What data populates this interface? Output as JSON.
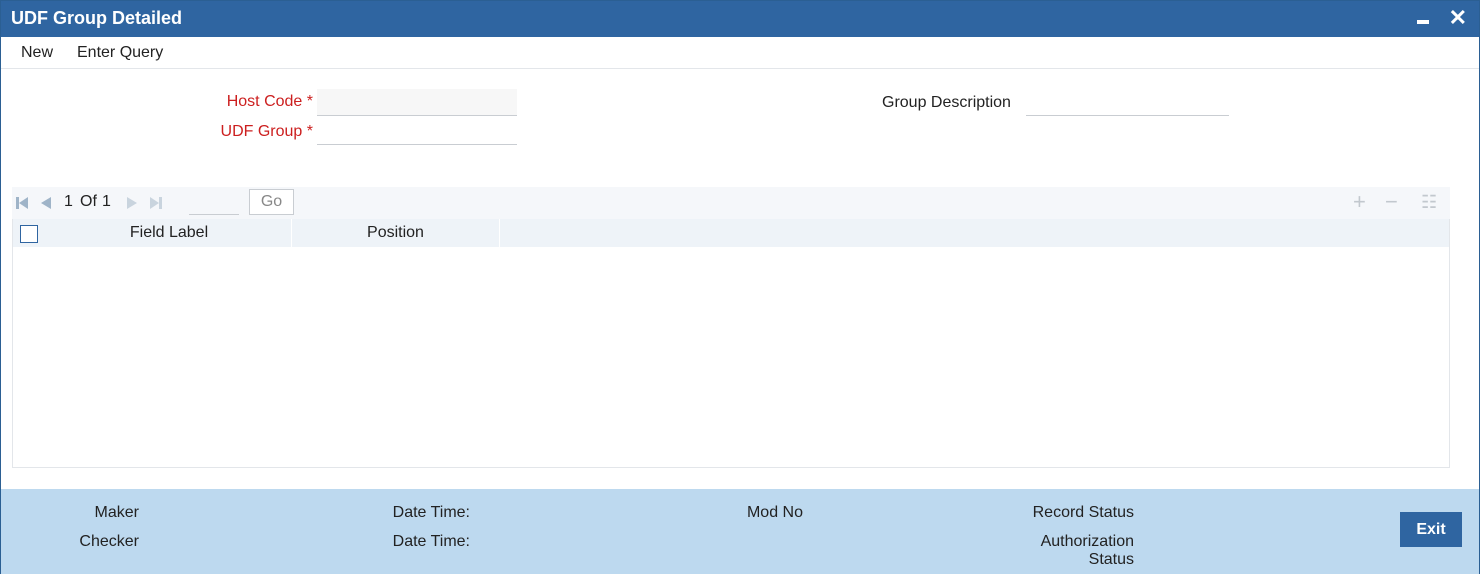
{
  "window": {
    "title": "UDF Group Detailed",
    "minimize_icon": "minimize-icon",
    "close_symbol": "✕"
  },
  "menu": {
    "new_label": "New",
    "enter_query_label": "Enter Query"
  },
  "form": {
    "host_code_label": "Host Code",
    "host_code_value": "",
    "udf_group_label": "UDF Group",
    "udf_group_value": "",
    "required_marker": "*",
    "group_description_label": "Group Description",
    "group_description_value": ""
  },
  "pager": {
    "current_page": "1",
    "of_label": "Of",
    "total_pages": "1",
    "go_label": "Go",
    "add_symbol": "+",
    "remove_symbol": "−",
    "view_symbol": "☷"
  },
  "grid": {
    "columns": [
      "Field Label",
      "Position"
    ],
    "rows": []
  },
  "footer": {
    "maker_label": "Maker",
    "checker_label": "Checker",
    "date_time_label_1": "Date Time:",
    "date_time_label_2": "Date Time:",
    "mod_no_label": "Mod No",
    "record_status_label": "Record Status",
    "authorization_status_line1": "Authorization",
    "authorization_status_line2": "Status",
    "exit_label": "Exit"
  },
  "colors": {
    "title_bar": "#2f65a1",
    "footer_bg": "#bdd9ef",
    "required_label": "#cc1f1f"
  }
}
